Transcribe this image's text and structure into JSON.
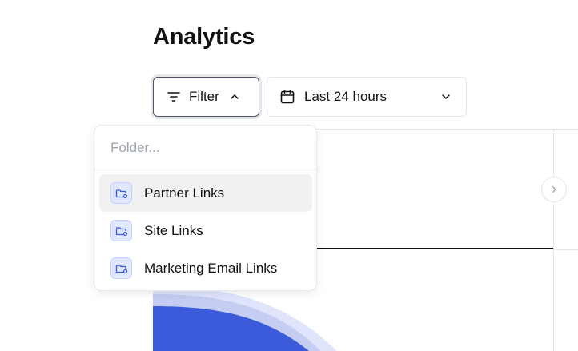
{
  "header": {
    "title": "Analytics"
  },
  "toolbar": {
    "filter_label": "Filter",
    "date_range_label": "Last 24 hours"
  },
  "folder_dropdown": {
    "search_placeholder": "Folder...",
    "items": [
      {
        "label": "Partner Links",
        "icon": "folder-link-icon",
        "active": true
      },
      {
        "label": "Site Links",
        "icon": "folder-link-icon",
        "active": false
      },
      {
        "label": "Marketing Email Links",
        "icon": "folder-link-icon",
        "active": false
      }
    ]
  },
  "colors": {
    "accent": "#3b5bdb",
    "accent_light": "#c5cdf3",
    "badge_bg": "#e0e7ff"
  }
}
